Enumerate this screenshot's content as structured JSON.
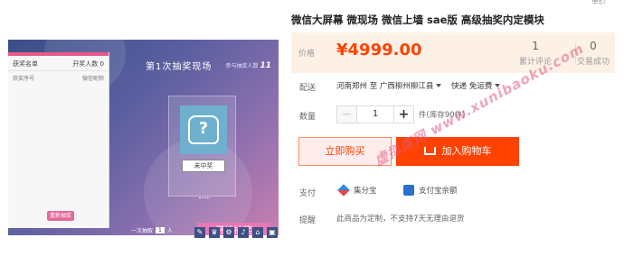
{
  "product": {
    "title": "微信大屏幕 微现场 微信上墙 sae版 高级抽奖内定模块",
    "price_label": "价格",
    "price": "¥4999.00",
    "stats": [
      {
        "value": "1",
        "label": "累计评论"
      },
      {
        "value": "0",
        "label": "交易成功"
      }
    ]
  },
  "delivery": {
    "label": "配送",
    "from": "河南郑州 至",
    "to": "广西柳州柳江县",
    "method": "快递 免运费"
  },
  "quantity": {
    "label": "数量",
    "minus": "−",
    "value": "1",
    "plus": "+",
    "stock": "件(库存90件)"
  },
  "actions": {
    "buy_now": "立即购买",
    "add_to_cart": "加入购物车"
  },
  "payment": {
    "label": "支付",
    "methods": [
      "集分宝",
      "支付宝余额"
    ]
  },
  "notice": {
    "label": "提醒",
    "text": "此商品为定制，不支持7天无理由退货"
  },
  "preview": {
    "winner_list_title": "获奖名单",
    "winner_list_right": "开奖人数 0",
    "col_prize": "获奖序号",
    "col_name": "微信昵称",
    "winner_button": "重新抽奖",
    "scene_title": "第1次抽奖现场",
    "participants_label": "参与抽奖人数",
    "participants_value": "11",
    "avatar_label": "未中奖",
    "draw_count_label": "一次抽取",
    "draw_count_value": "1",
    "draw_count_unit": "人",
    "draw_button": "开始抽奖",
    "toolbar_icons": [
      "✎",
      "♛",
      "⚙",
      "♪",
      "⌂",
      "▣"
    ]
  },
  "watermark": "虚拟库网 www.xunibaoku.com",
  "top_sliver": "单价"
}
